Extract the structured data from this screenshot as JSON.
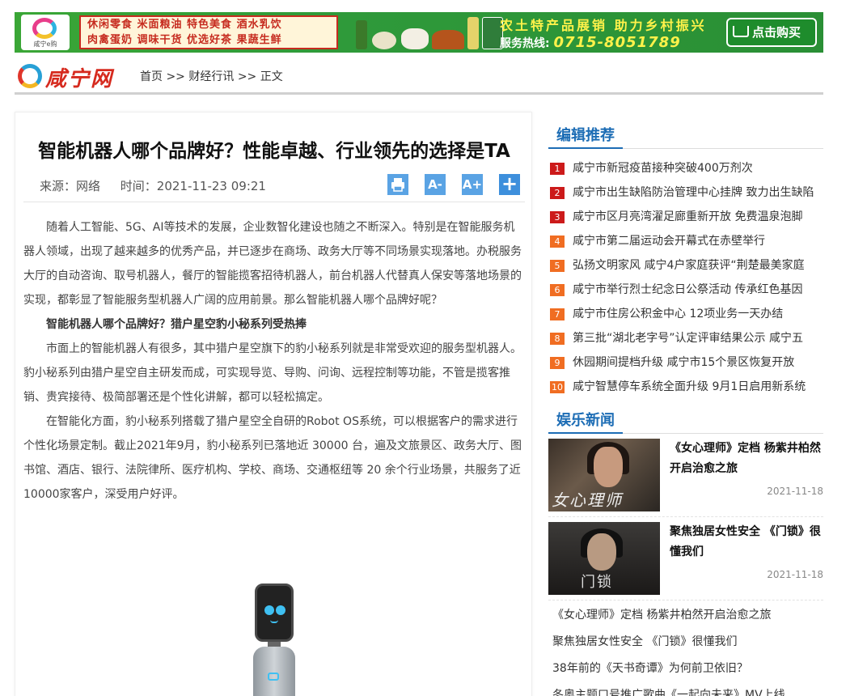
{
  "banner": {
    "logo_text": "咸宁e购",
    "categories_row1": "休闲零食 米面粮油 特色美食 酒水乳饮",
    "categories_row2": "肉禽蛋奶 调味干货 优选好茶 果蔬生鲜",
    "slogan": "农土特产品展销 助力乡村振兴",
    "hotline_label": "服务热线:",
    "hotline_number": "0715-8051789",
    "buy_label": "点击购买"
  },
  "header": {
    "logo_text": "咸宁网",
    "breadcrumb": [
      "首页",
      ">>",
      "财经行讯",
      ">>",
      "正文"
    ]
  },
  "article": {
    "title": "智能机器人哪个品牌好？性能卓越、行业领先的选择是TA",
    "source": "来源：网络",
    "time": "时间：2021-11-23 09:21",
    "tools": {
      "minus": "A-",
      "plus": "A+",
      "add": "+"
    },
    "paragraphs": [
      "随着人工智能、5G、AI等技术的发展，企业数智化建设也随之不断深入。特别是在智能服务机器人领域，出现了越来越多的优秀产品，并已逐步在商场、政务大厅等不同场景实现落地。办税服务大厅的自动咨询、取号机器人，餐厅的智能揽客招待机器人，前台机器人代替真人保安等落地场景的实现，都彰显了智能服务型机器人广阔的应用前景。那么智能机器人哪个品牌好呢？",
      "智能机器人哪个品牌好？猎户星空豹小秘系列受热捧",
      "市面上的智能机器人有很多，其中猎户星空旗下的豹小秘系列就是非常受欢迎的服务型机器人。豹小秘系列由猎户星空自主研发而成，可实现导览、导购、问询、远程控制等功能，不管是揽客推销、贵宾接待、极简部署还是个性化讲解，都可以轻松搞定。",
      "在智能化方面，豹小秘系列搭载了猎户星空全自研的Robot OS系统，可以根据客户的需求进行个性化场景定制。截止2021年9月，豹小秘系列已落地近 30000 台，遍及文旅景区、政务大厅、图书馆、酒店、银行、法院律所、医疗机构、学校、商场、交通枢纽等 20 余个行业场景，共服务了近10000家客户，深受用户好评。"
    ]
  },
  "sidebar": {
    "editor_title": "编辑推荐",
    "editor_items": [
      {
        "num": "1",
        "text": "咸宁市新冠疫苗接种突破400万剂次"
      },
      {
        "num": "2",
        "text": "咸宁市出生缺陷防治管理中心挂牌  致力出生缺陷"
      },
      {
        "num": "3",
        "text": "咸宁市区月亮湾濯足廊重新开放  免费温泉泡脚"
      },
      {
        "num": "4",
        "text": "咸宁市第二届运动会开幕式在赤壁举行"
      },
      {
        "num": "5",
        "text": "弘扬文明家风  咸宁4户家庭获评“荆楚最美家庭"
      },
      {
        "num": "6",
        "text": "咸宁市举行烈士纪念日公祭活动  传承红色基因"
      },
      {
        "num": "7",
        "text": "咸宁市住房公积金中心  12项业务一天办结"
      },
      {
        "num": "8",
        "text": "第三批“湖北老字号”认定评审结果公示  咸宁五"
      },
      {
        "num": "9",
        "text": "休园期间提档升级  咸宁市15个景区恢复开放"
      },
      {
        "num": "10",
        "text": "咸宁智慧停车系统全面升级  9月1日启用新系统"
      }
    ],
    "ent_title": "娱乐新闻",
    "ent_items": [
      {
        "title": "《女心理师》定档 杨紫井柏然开启治愈之旅",
        "date": "2021-11-18",
        "thumb_text": "女心理师"
      },
      {
        "title": "聚焦独居女性安全 《门锁》很懂我们",
        "date": "2021-11-18",
        "thumb_text": "门锁"
      }
    ],
    "text_items": [
      "《女心理师》定档 杨紫井柏然开启治愈之旅",
      "聚焦独居女性安全 《门锁》很懂我们",
      "38年前的《天书奇谭》为何前卫依旧？",
      "冬奥主题口号推广歌曲《一起向未来》MV上线"
    ]
  }
}
